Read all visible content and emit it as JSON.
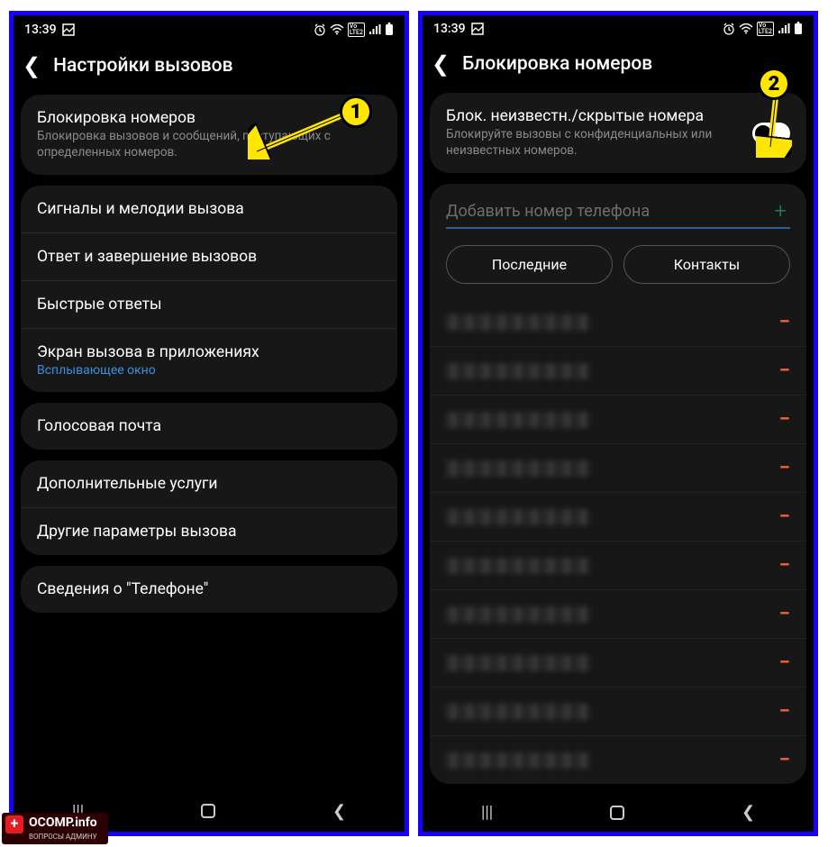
{
  "status": {
    "time": "13:39"
  },
  "left": {
    "title": "Настройки вызовов",
    "g1": {
      "blockTitle": "Блокировка номеров",
      "blockSub": "Блокировка вызовов и сообщений, поступающих с определенных номеров."
    },
    "g2": {
      "ringtones": "Сигналы и мелодии вызова",
      "answer": "Ответ и завершение вызовов",
      "quick": "Быстрые ответы",
      "screen": "Экран вызова в приложениях",
      "screenSub": "Всплывающее окно"
    },
    "g3": {
      "vm": "Голосовая почта"
    },
    "g4": {
      "extra": "Дополнительные услуги",
      "other": "Другие параметры вызова"
    },
    "g5": {
      "about": "Сведения о \"Телефоне\""
    }
  },
  "right": {
    "title": "Блокировка номеров",
    "toggleTitle": "Блок. неизвестн./скрытые номера",
    "toggleSub": "Блокируйте вызовы с конфиденциальных или неизвестных номеров.",
    "addPlaceholder": "Добавить номер телефона",
    "recent": "Последние",
    "contacts": "Контакты",
    "rows": 10
  },
  "badges": {
    "one": "1",
    "two": "2"
  },
  "watermark": {
    "main": "OCOMP.info",
    "sub": "ВОПРОСЫ АДМИНУ"
  }
}
